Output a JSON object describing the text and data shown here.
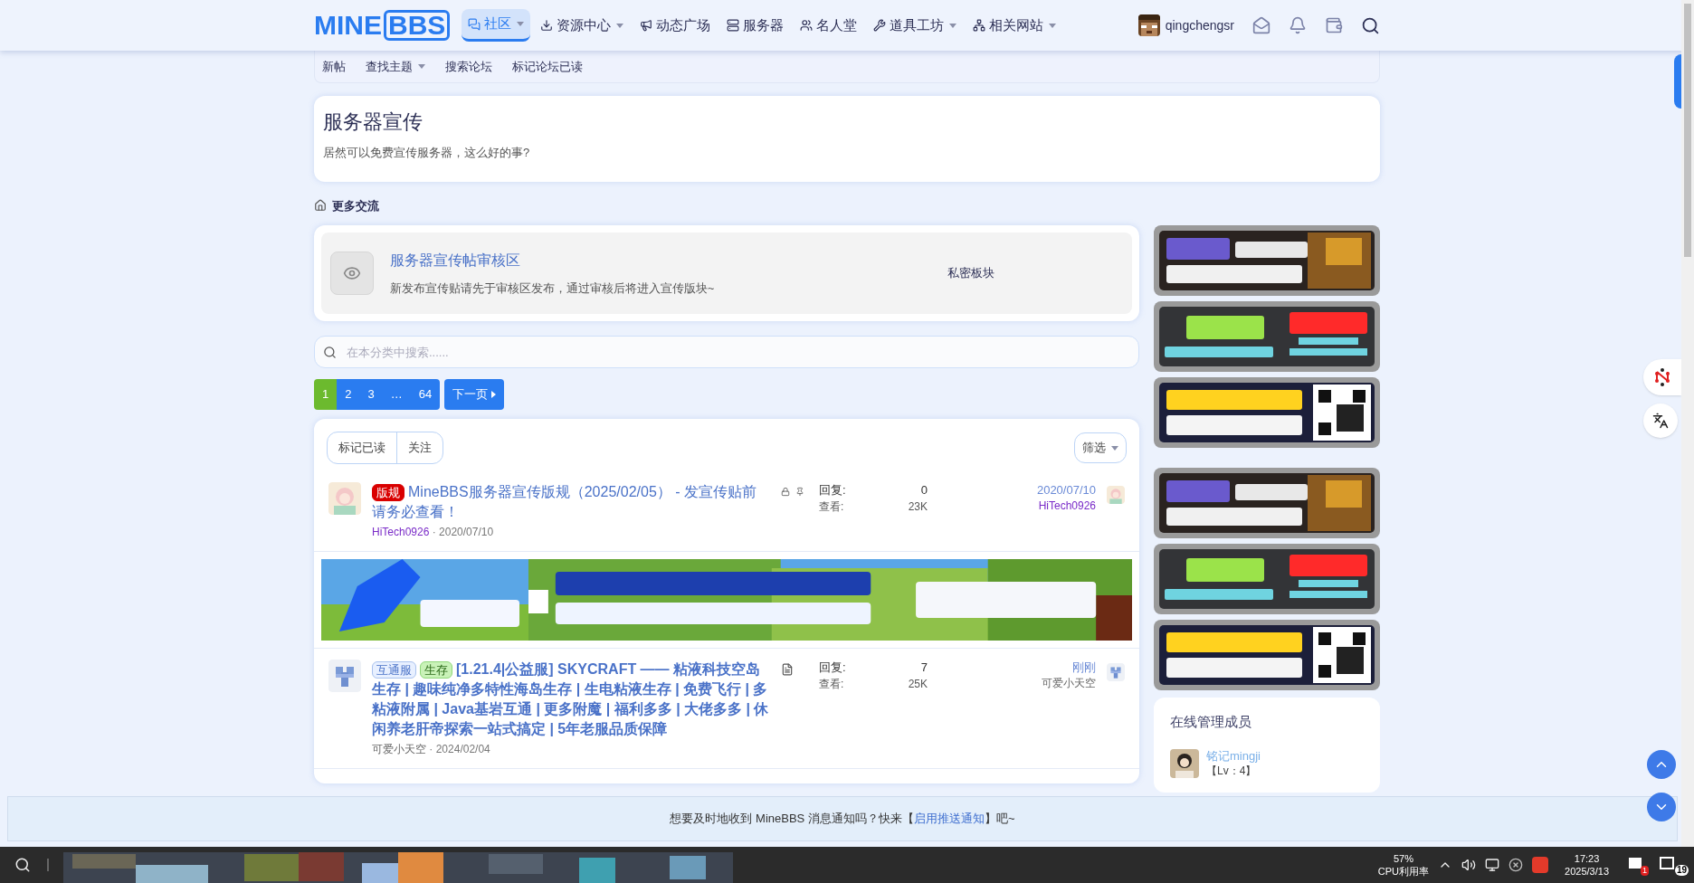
{
  "logo": {
    "left": "MINE",
    "boxed": "BBS"
  },
  "nav": [
    {
      "label": "社区",
      "caret": true,
      "selected": true
    },
    {
      "label": "资源中心",
      "caret": true,
      "selected": false
    },
    {
      "label": "动态广场",
      "caret": false,
      "selected": false
    },
    {
      "label": "服务器",
      "caret": false,
      "selected": false
    },
    {
      "label": "名人堂",
      "caret": false,
      "selected": false
    },
    {
      "label": "道具工坊",
      "caret": true,
      "selected": false
    },
    {
      "label": "相关网站",
      "caret": true,
      "selected": false
    }
  ],
  "user": {
    "name": "qingchengsr"
  },
  "subnav": [
    {
      "label": "新帖",
      "caret": false
    },
    {
      "label": "查找主题",
      "caret": true
    },
    {
      "label": "搜索论坛",
      "caret": false
    },
    {
      "label": "标记论坛已读",
      "caret": false
    }
  ],
  "forum": {
    "title": "服务器宣传",
    "description": "居然可以免费宣传服务器，这么好的事?"
  },
  "breadcrumb": "更多交流",
  "subforum": {
    "title": "服务器宣传帖审核区",
    "description": "新发布宣传贴请先于审核区发布，通过审核后将进入宣传版块~",
    "status": "私密板块"
  },
  "search": {
    "placeholder": "在本分类中搜索......"
  },
  "pagination": {
    "pages": [
      {
        "label": "1",
        "selected": true
      },
      {
        "label": "2",
        "selected": false
      },
      {
        "label": "3",
        "selected": false
      },
      {
        "label": "…",
        "selected": false
      },
      {
        "label": "64",
        "selected": false
      }
    ],
    "next": "下一页"
  },
  "list_actions": [
    "标记已读",
    "关注"
  ],
  "filter": "筛选",
  "threads": [
    {
      "kind": "thread",
      "unread": false,
      "prefixes": [
        {
          "label": "版规",
          "kind": "rule"
        }
      ],
      "title": "MineBBS服务器宣传版规（2025/02/05） - 发宣传贴前请务必查看！",
      "flags": [
        {
          "kind": "lock"
        },
        {
          "kind": "pin"
        }
      ],
      "author": "HiTech0926",
      "separator": "·",
      "date": "2020/07/10",
      "replies_label": "回复:",
      "replies": "0",
      "views_label": "查看:",
      "views": "23K",
      "last_time": "2020/07/10",
      "last_user": "HiTech0926",
      "color": "#7a2bc8"
    },
    {
      "kind": "banner"
    },
    {
      "kind": "thread",
      "unread": true,
      "prefixes": [
        {
          "label": "互通服",
          "kind": "blue"
        },
        {
          "label": "生存",
          "kind": "green"
        }
      ],
      "title": "[1.21.4|公益服] SKYCRAFT —— 粘液科技空岛生存 | 趣味纯净多特性海岛生存 | 生电粘液生存 | 免费飞行 | 多粘液附属 | Java基岩互通 | 更多附魔 | 福利多多 | 大佬多多 | 休闲养老肝帝探索一站式搞定 |  5年老服品质保障",
      "flags": [
        {
          "kind": "document"
        }
      ],
      "author": "可爱小天空",
      "separator": "·",
      "date": "2024/02/04",
      "replies_label": "回复:",
      "replies": "7",
      "views_label": "查看:",
      "views": "25K",
      "last_time": "刚刚",
      "last_user": "可爱小天空",
      "color": "#666666"
    }
  ],
  "sidebar_ads": [
    {
      "kind": "purple"
    },
    {
      "kind": "green"
    },
    {
      "kind": "qr"
    },
    {
      "kind": "purple"
    },
    {
      "kind": "green"
    },
    {
      "kind": "qr"
    }
  ],
  "staff": {
    "title": "在线管理成员",
    "members": [
      {
        "name": "铭记mingji",
        "level": "【Lv：4】"
      }
    ]
  },
  "notice": {
    "before": "想要及时地收到 MineBBS 消息通知吗？快来【",
    "link": "启用推送通知",
    "after": "】吧~"
  },
  "taskbar": {
    "cpu": "57%",
    "cpu_label": "CPU利用率",
    "time": "17:23",
    "date": "2025/3/13",
    "alert_count": "1",
    "message_count": "19"
  }
}
